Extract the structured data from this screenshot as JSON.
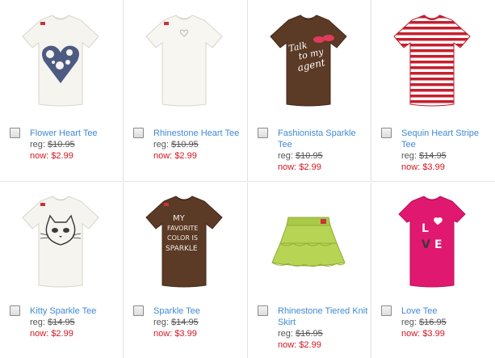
{
  "products": [
    {
      "name": "Flower Heart Tee",
      "reg_label": "reg:",
      "reg_price": "$10.95",
      "now_label": "now:",
      "now_price": "$2.99",
      "icon": "white-tee-flower-heart"
    },
    {
      "name": "Rhinestone Heart Tee",
      "reg_label": "reg:",
      "reg_price": "$10.95",
      "now_label": "now:",
      "now_price": "$2.99",
      "icon": "white-tee-small-heart"
    },
    {
      "name": "Fashionista Sparkle Tee",
      "reg_label": "reg:",
      "reg_price": "$10.95",
      "now_label": "now:",
      "now_price": "$2.99",
      "icon": "brown-tee-talk-to-my-agent",
      "graphic_text": "Talk to my agent"
    },
    {
      "name": "Sequin Heart Stripe Tee",
      "reg_label": "reg:",
      "reg_price": "$14.95",
      "now_label": "now:",
      "now_price": "$3.99",
      "icon": "red-white-stripe-tee"
    },
    {
      "name": "Kitty Sparkle Tee",
      "reg_label": "reg:",
      "reg_price": "$14.95",
      "now_label": "now:",
      "now_price": "$2.99",
      "icon": "white-tee-kitty"
    },
    {
      "name": "Sparkle Tee",
      "reg_label": "reg:",
      "reg_price": "$14.95",
      "now_label": "now:",
      "now_price": "$3.99",
      "icon": "brown-tee-sparkle-text",
      "graphic_text": "MY FAVORITE COLOR IS SPARKLE"
    },
    {
      "name": "Rhinestone Tiered Knit Skirt",
      "reg_label": "reg:",
      "reg_price": "$16.95",
      "now_label": "now:",
      "now_price": "$2.99",
      "icon": "green-tiered-skirt"
    },
    {
      "name": "Love Tee",
      "reg_label": "reg:",
      "reg_price": "$16.95",
      "now_label": "now:",
      "now_price": "$3.99",
      "icon": "pink-tee-love",
      "graphic_text": "LOVE"
    }
  ],
  "colors": {
    "link": "#3f8ad4",
    "sale": "#d4161f",
    "regular": "#555555",
    "border": "#e2e2e2"
  }
}
